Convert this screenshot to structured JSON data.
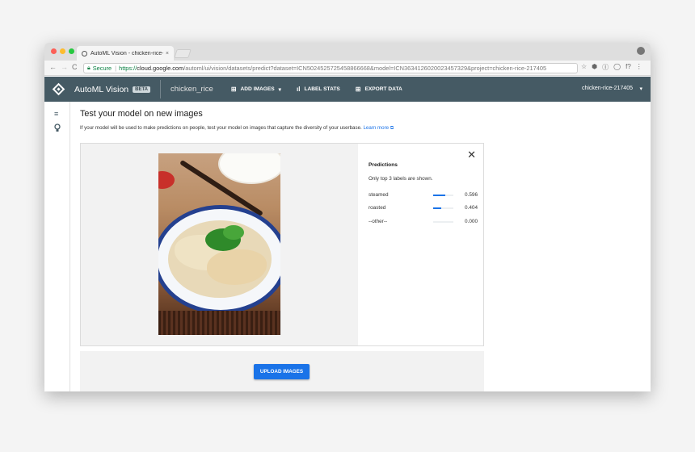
{
  "browser": {
    "tab_title": "AutoML Vision - chicken-rice-",
    "tab_close": "×",
    "back": "←",
    "forward": "→",
    "reload": "C",
    "secure_label": "Secure",
    "url_scheme": "https://",
    "url_host": "cloud.google.com",
    "url_path": "/automl/ui/vision/datasets/predict?dataset=ICN5024525725458866668&model=ICN3634126020023457329&project=chicken-rice-217405",
    "ext": [
      "☆",
      "⬢",
      "Ⓘ",
      "◯",
      "f?",
      "⋮"
    ]
  },
  "header": {
    "brand": "AutoML Vision",
    "beta": "BETA",
    "dataset": "chicken_rice",
    "add_images": "ADD IMAGES",
    "add_images_caret": "▾",
    "label_stats": "LABEL STATS",
    "export_data": "EXPORT DATA",
    "project": "chicken-rice-217405",
    "project_caret": "▾"
  },
  "rail": {
    "list_icon": "≡",
    "bulb_icon": "⚲"
  },
  "main": {
    "title": "Test your model on new images",
    "description": "If your model will be used to make predictions on people, test your model on images that capture the diversity of your userbase.",
    "learn_more": "Learn more",
    "learn_more_icon": "⧉"
  },
  "predictions": {
    "close": "✕",
    "title": "Predictions",
    "note": "Only top 3 labels are shown.",
    "items": [
      {
        "label": "steamed",
        "score": 0.596,
        "score_text": "0.596"
      },
      {
        "label": "roasted",
        "score": 0.404,
        "score_text": "0.404"
      },
      {
        "label": "--other--",
        "score": 0.0,
        "score_text": "0.000"
      }
    ]
  },
  "upload": {
    "button": "UPLOAD IMAGES"
  },
  "colors": {
    "header_bg": "#455a64",
    "accent": "#1a73e8"
  }
}
